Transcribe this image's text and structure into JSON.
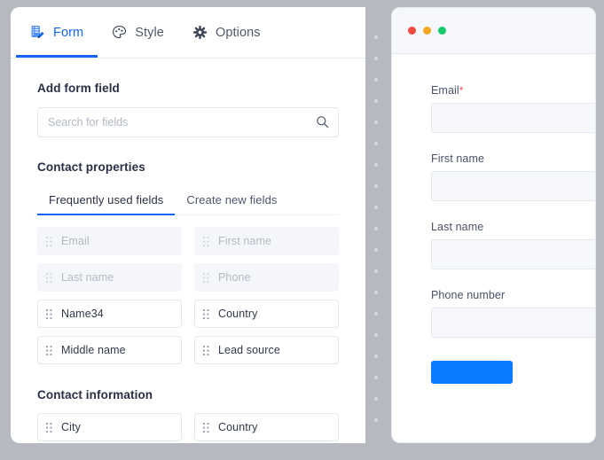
{
  "theme": {
    "accent_blue": "#1565f5",
    "submit_blue": "#0a7cff",
    "required_red": "#f2545b",
    "page_background": "#b6bac0"
  },
  "editor": {
    "tabs": [
      {
        "label": "Form",
        "icon": "form-icon",
        "active": true
      },
      {
        "label": "Style",
        "icon": "palette-icon",
        "active": false
      },
      {
        "label": "Options",
        "icon": "gear-icon",
        "active": false
      }
    ],
    "add_form_field": {
      "title": "Add form field",
      "search_placeholder": "Search for fields",
      "search_value": "",
      "search_icon": "search-icon"
    },
    "contact_properties": {
      "title": "Contact properties",
      "subtabs": [
        {
          "label": "Frequently used fields",
          "active": true
        },
        {
          "label": "Create new fields",
          "active": false
        }
      ],
      "fields": [
        {
          "label": "Email",
          "enabled": false
        },
        {
          "label": "First name",
          "enabled": false
        },
        {
          "label": "Last name",
          "enabled": false
        },
        {
          "label": "Phone",
          "enabled": false
        },
        {
          "label": "Name34",
          "enabled": true
        },
        {
          "label": "Country",
          "enabled": true
        },
        {
          "label": "Middle name",
          "enabled": true
        },
        {
          "label": "Lead source",
          "enabled": true
        }
      ]
    },
    "contact_information": {
      "title": "Contact information",
      "fields": [
        {
          "label": "City",
          "enabled": true
        },
        {
          "label": "Country",
          "enabled": true
        }
      ]
    }
  },
  "preview": {
    "window_dots": [
      {
        "name": "close-dot",
        "color": "#f04a40"
      },
      {
        "name": "minimize-dot",
        "color": "#f5a623"
      },
      {
        "name": "maximize-dot",
        "color": "#13c96b"
      }
    ],
    "fields": [
      {
        "label": "Email",
        "required": true,
        "required_mark": "*",
        "value": ""
      },
      {
        "label": "First name",
        "required": false,
        "required_mark": "",
        "value": ""
      },
      {
        "label": "Last name",
        "required": false,
        "required_mark": "",
        "value": ""
      },
      {
        "label": "Phone number",
        "required": false,
        "required_mark": "",
        "value": ""
      }
    ],
    "submit_label": ""
  }
}
